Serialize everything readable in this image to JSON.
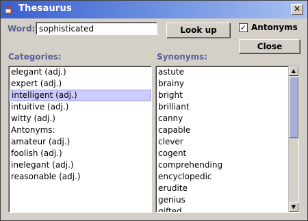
{
  "window": {
    "title": "Thesaurus",
    "close_glyph": "✕"
  },
  "word_label": "Word:",
  "word_value": "sophisticated",
  "lookup_button": "Look up",
  "antonyms": {
    "label": "Antonyms",
    "checked": true,
    "check_glyph": "✓"
  },
  "close_button": "Close",
  "categories": {
    "label": "Categories:",
    "items": [
      "elegant (adj.)",
      "expert (adj.)",
      "intelligent (adj.)",
      "intuitive (adj.)",
      "witty (adj.)",
      "Antonyms:",
      "amateur (adj.)",
      "foolish (adj.)",
      "inelegant (adj.)",
      "reasonable (adj.)"
    ],
    "selected": "intelligent (adj.)"
  },
  "synonyms": {
    "label": "Synonyms:",
    "items": [
      "astute",
      "brainy",
      "bright",
      "brilliant",
      "canny",
      "capable",
      "clever",
      "cogent",
      "comprehending",
      "encyclopedic",
      "erudite",
      "genius",
      "gifted"
    ]
  },
  "colors": {
    "titlebar": "#3a5fcd",
    "label": "#5a5f96",
    "selection": "#ccccff"
  }
}
